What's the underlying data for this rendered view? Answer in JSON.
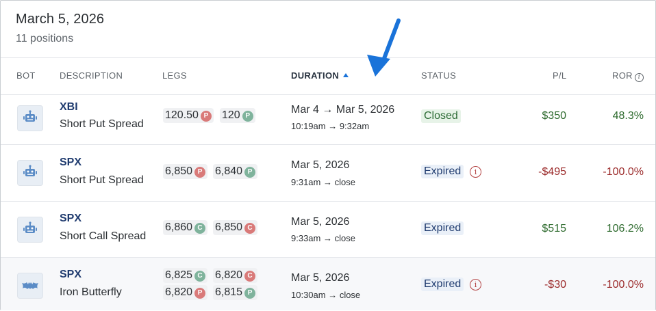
{
  "header": {
    "title": "March 5, 2026",
    "subtitle": "11 positions"
  },
  "columns": {
    "bot": "BOT",
    "description": "DESCRIPTION",
    "legs": "LEGS",
    "duration": "DURATION",
    "status": "STATUS",
    "pl": "P/L",
    "ror": "ROR",
    "info_glyph": "i"
  },
  "rows": [
    {
      "symbol": "XBI",
      "strategy": "Short Put Spread",
      "bot_icon": "robot-icon",
      "legs": [
        {
          "strike": "120.50",
          "type": "P"
        },
        {
          "strike": "120",
          "type": "P"
        }
      ],
      "duration_main": "Mar 4 → Mar 5, 2026",
      "duration_time": "10:19am → 9:32am",
      "status": "Closed",
      "pl": "$350",
      "ror": "48.3%"
    },
    {
      "symbol": "SPX",
      "strategy": "Short Put Spread",
      "bot_icon": "robot-icon",
      "legs": [
        {
          "strike": "6,850",
          "type": "P"
        },
        {
          "strike": "6,840",
          "type": "P"
        }
      ],
      "duration_main": "Mar 5, 2026",
      "duration_time": "9:31am → close",
      "status": "Expired",
      "pl": "-$495",
      "ror": "-100.0%"
    },
    {
      "symbol": "SPX",
      "strategy": "Short Call Spread",
      "bot_icon": "robot-icon",
      "legs": [
        {
          "strike": "6,860",
          "type": "C"
        },
        {
          "strike": "6,850",
          "type": "C"
        }
      ],
      "duration_main": "Mar 5, 2026",
      "duration_time": "9:33am → close",
      "status": "Expired",
      "pl": "$515",
      "ror": "106.2%"
    },
    {
      "symbol": "SPX",
      "strategy": "Iron Butterfly",
      "bot_icon": "bat-icon",
      "legs": [
        {
          "strike": "6,825",
          "type": "C"
        },
        {
          "strike": "6,820",
          "type": "C"
        },
        {
          "strike": "6,820",
          "type": "P"
        },
        {
          "strike": "6,815",
          "type": "P"
        }
      ],
      "duration_main": "Mar 5, 2026",
      "duration_time": "10:30am → close",
      "status": "Expired",
      "pl": "-$30",
      "ror": "-100.0%"
    }
  ],
  "colors": {
    "positive": "#2e6b2e",
    "negative": "#9b2a2a",
    "accent": "#1a73d9",
    "pill_red": "#d97a79",
    "pill_green": "#7fb39c"
  }
}
